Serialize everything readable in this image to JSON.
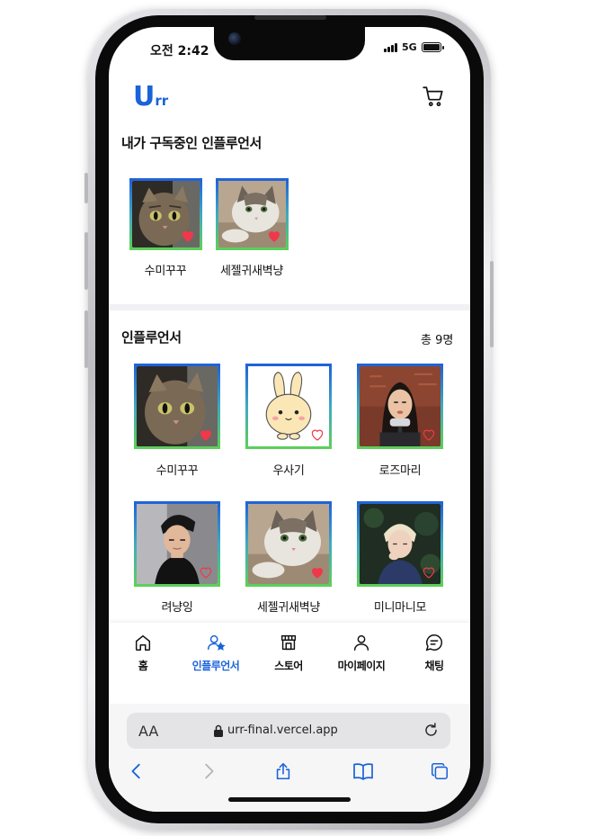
{
  "status": {
    "time": "오전 2:42",
    "network": "5G"
  },
  "header": {
    "logo_main": "U",
    "logo_small": "rr"
  },
  "subscribed": {
    "title": "내가 구독중인 인플루언서",
    "items": [
      {
        "name": "수미꾸꾸",
        "subscribed": true
      },
      {
        "name": "세젤귀새벽냥",
        "subscribed": true
      }
    ]
  },
  "influencers": {
    "title": "인플루언서",
    "total": "총 9명",
    "items": [
      {
        "name": "수미꾸꾸",
        "subscribed": true
      },
      {
        "name": "우사기",
        "subscribed": false
      },
      {
        "name": "로즈마리",
        "subscribed": false
      },
      {
        "name": "려냥잉",
        "subscribed": false
      },
      {
        "name": "세젤귀새벽냥",
        "subscribed": true
      },
      {
        "name": "미니마니모",
        "subscribed": false
      }
    ]
  },
  "nav": {
    "items": [
      {
        "label": "홈",
        "icon": "home-icon",
        "active": false
      },
      {
        "label": "인플루언서",
        "icon": "influencer-icon",
        "active": true
      },
      {
        "label": "스토어",
        "icon": "store-icon",
        "active": false
      },
      {
        "label": "마이페이지",
        "icon": "person-icon",
        "active": false
      },
      {
        "label": "채팅",
        "icon": "chat-icon",
        "active": false
      }
    ]
  },
  "browser": {
    "aa": "AA",
    "url": "urr-final.vercel.app"
  },
  "colors": {
    "brand": "#1a63d8",
    "heart": "#f0384a",
    "border_top": "#1f63d8",
    "border_bottom": "#5ccf5a"
  }
}
